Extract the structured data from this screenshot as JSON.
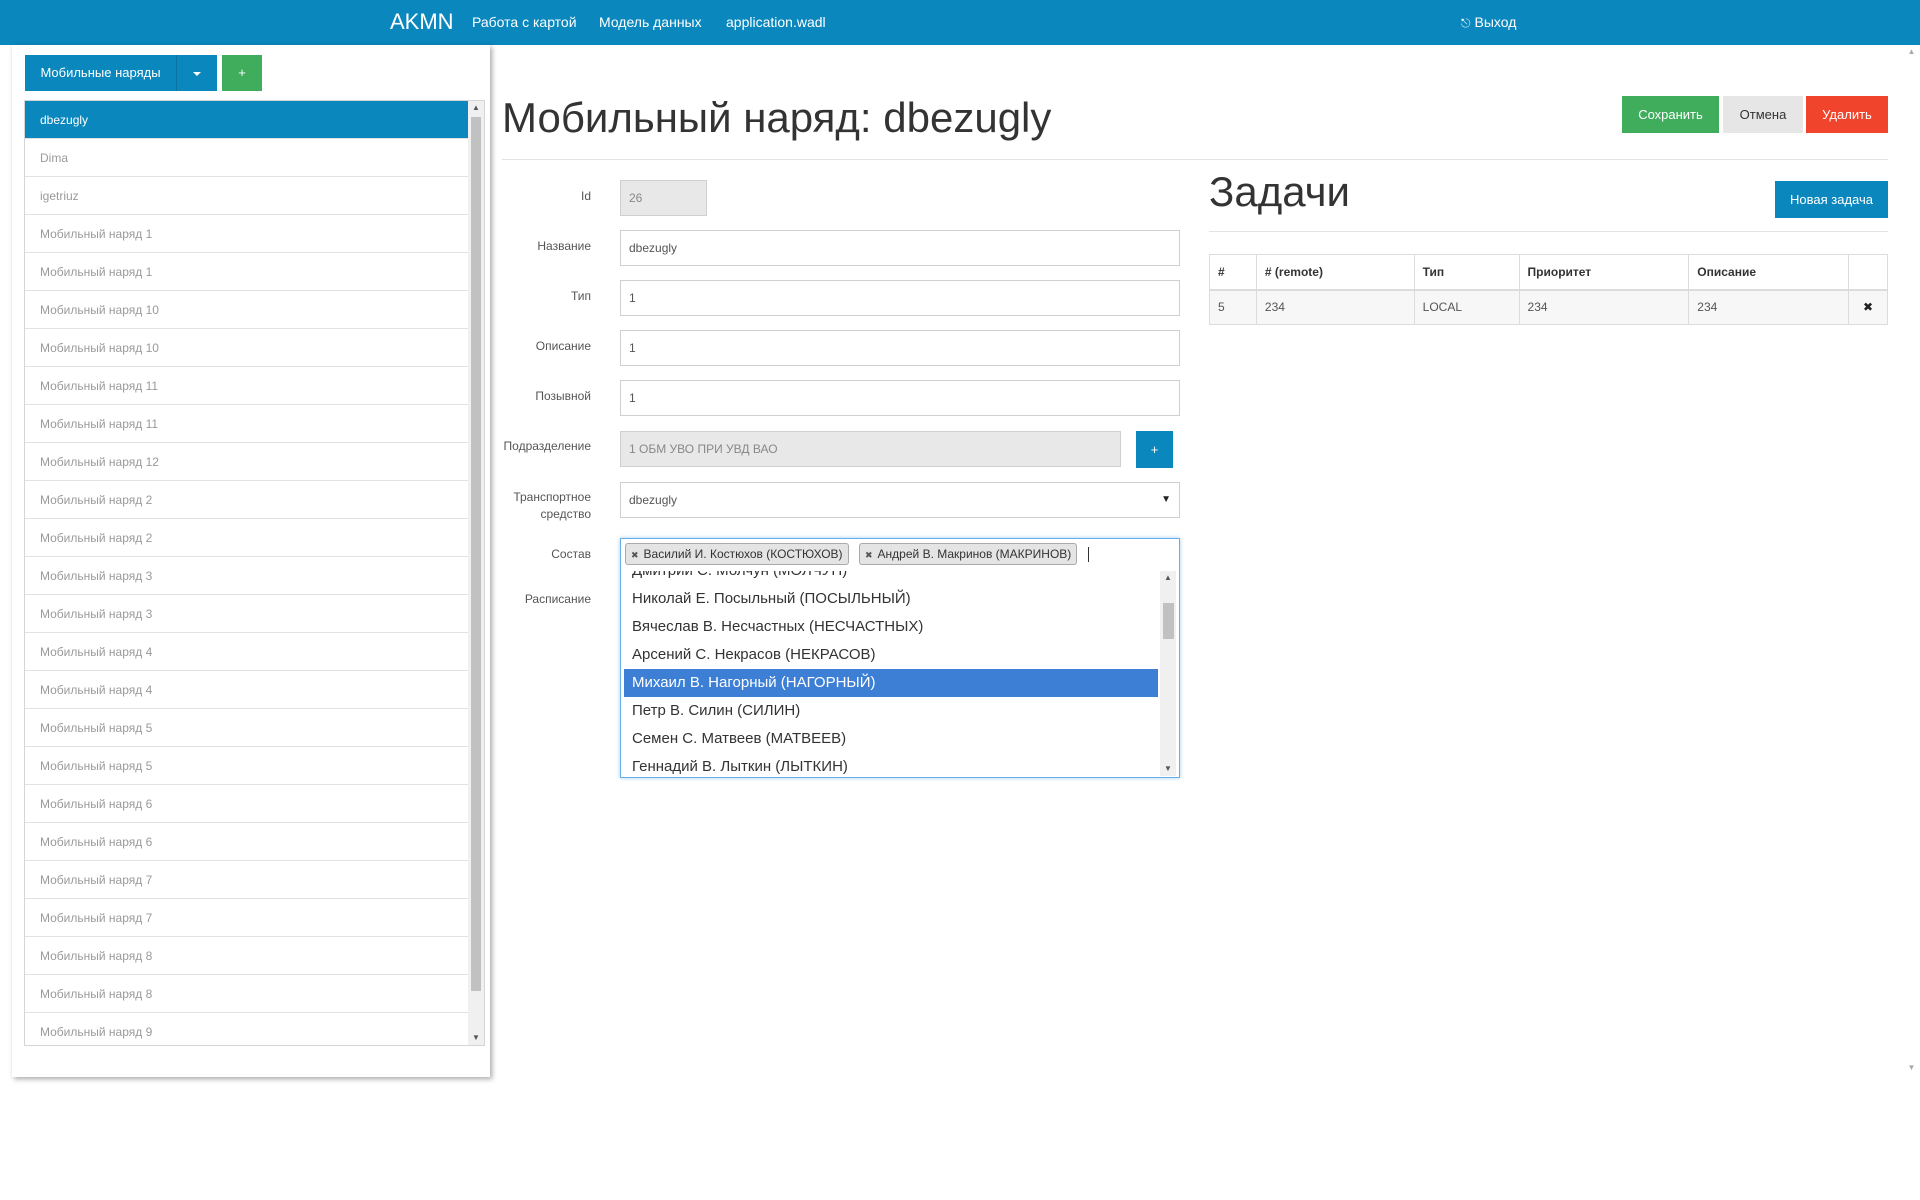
{
  "navbar": {
    "brand": "AKMN",
    "links": [
      "Работа с картой",
      "Модель данных",
      "application.wadl"
    ],
    "logout": "Выход"
  },
  "sidebar": {
    "dropdown_label": "Мобильные наряды",
    "add_label": "+",
    "items": [
      "dbezugly",
      "Dima",
      "igetriuz",
      "Мобильный наряд 1",
      "Мобильный наряд 1",
      "Мобильный наряд 10",
      "Мобильный наряд 10",
      "Мобильный наряд 11",
      "Мобильный наряд 11",
      "Мобильный наряд 12",
      "Мобильный наряд 2",
      "Мобильный наряд 2",
      "Мобильный наряд 3",
      "Мобильный наряд 3",
      "Мобильный наряд 4",
      "Мобильный наряд 4",
      "Мобильный наряд 5",
      "Мобильный наряд 5",
      "Мобильный наряд 6",
      "Мобильный наряд 6",
      "Мобильный наряд 7",
      "Мобильный наряд 7",
      "Мобильный наряд 8",
      "Мобильный наряд 8",
      "Мобильный наряд 9"
    ],
    "active_index": 0
  },
  "header": {
    "title": "Мобильный наряд: dbezugly",
    "save": "Сохранить",
    "cancel": "Отмена",
    "delete": "Удалить"
  },
  "form": {
    "id_label": "Id",
    "id_value": "26",
    "name_label": "Название",
    "name_value": "dbezugly",
    "type_label": "Тип",
    "type_value": "1",
    "desc_label": "Описание",
    "desc_value": "1",
    "callsign_label": "Позывной",
    "callsign_value": "1",
    "unit_label": "Подразделение",
    "unit_value": "1 ОБМ УВО ПРИ УВД ВАО",
    "unit_add": "+",
    "vehicle_label": "Транспортное средство",
    "vehicle_value": "dbezugly",
    "crew_label": "Состав",
    "schedule_label": "Расписание",
    "crew_tags": [
      "Василий И. Костюхов (КОСТЮХОВ)",
      "Андрей В. Макринов (МАКРИНОВ)"
    ],
    "crew_options": [
      "Дмитрий С. Молчун (МОЛЧУН)",
      "Николай Е. Посыльный (ПОСЫЛЬНЫЙ)",
      "Вячеслав В. Несчастных (НЕСЧАСТНЫХ)",
      "Арсений С. Некрасов (НЕКРАСОВ)",
      "Михаил В. Нагорный (НАГОРНЫЙ)",
      "Петр В. Силин (СИЛИН)",
      "Семен С. Матвеев (МАТВЕЕВ)",
      "Геннадий В. Лыткин (ЛЫТКИН)"
    ],
    "highlighted_option_index": 4
  },
  "tasks": {
    "title": "Задачи",
    "new_task": "Новая задача",
    "columns": [
      "#",
      "# (remote)",
      "Тип",
      "Приоритет",
      "Описание"
    ],
    "rows": [
      [
        "5",
        "234",
        "LOCAL",
        "234",
        "234"
      ]
    ],
    "delete_icon": "✖"
  },
  "colors": {
    "primary": "#0a87bd",
    "success": "#3fad5c",
    "danger": "#f0452c",
    "highlight": "#3e7fd6"
  }
}
